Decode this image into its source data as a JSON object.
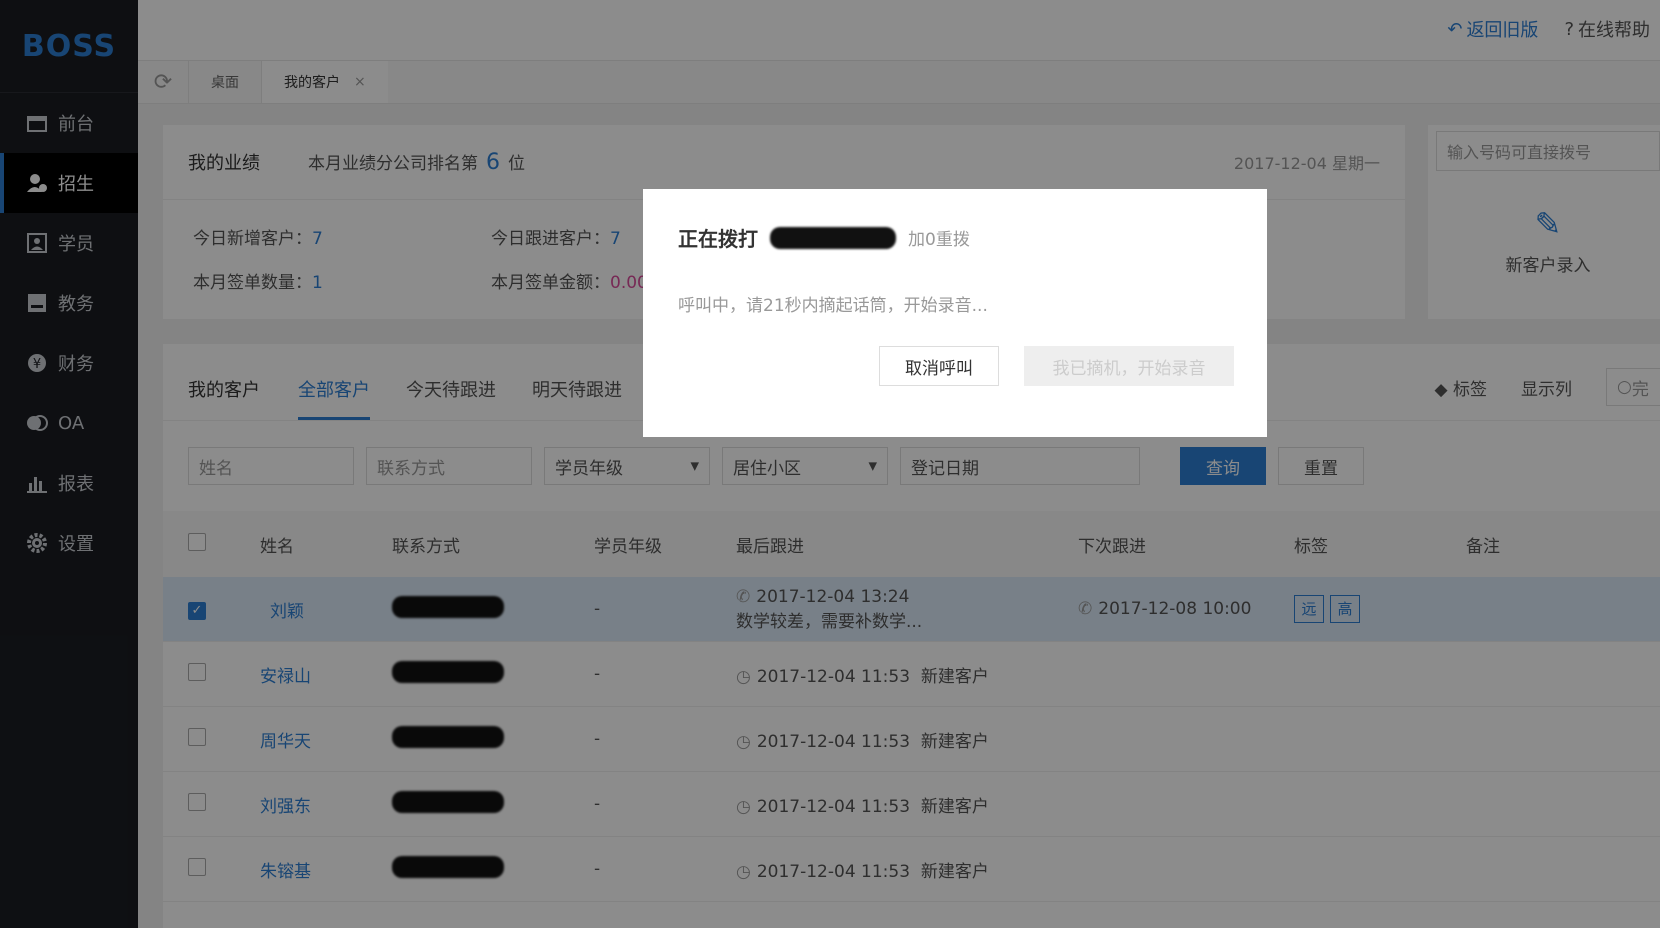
{
  "app": {
    "logo": "BOSS"
  },
  "sidebar": {
    "items": [
      {
        "label": "前台",
        "icon": "calendar-icon"
      },
      {
        "label": "招生",
        "icon": "user-add-icon",
        "active": true
      },
      {
        "label": "学员",
        "icon": "student-icon"
      },
      {
        "label": "教务",
        "icon": "book-icon"
      },
      {
        "label": "财务",
        "icon": "yen-icon"
      },
      {
        "label": "OA",
        "icon": "oa-icon"
      },
      {
        "label": "报表",
        "icon": "bar-chart-icon"
      },
      {
        "label": "设置",
        "icon": "gear-icon"
      }
    ]
  },
  "topbar": {
    "back_label": "返回旧版",
    "help_label": "在线帮助"
  },
  "tabs": {
    "home": "桌面",
    "current": "我的客户"
  },
  "performance": {
    "title": "我的业绩",
    "rank_prefix": "本月业绩分公司排名第",
    "rank_num": "6",
    "rank_suffix": "位",
    "date": "2017-12-04 星期一",
    "new_today_label": "今日新增客户：",
    "new_today": "7",
    "follow_today_label": "今日跟进客户：",
    "follow_today": "7",
    "signed_count_label": "本月签单数量：",
    "signed_count": "1",
    "signed_amount_label": "本月签单金额：",
    "signed_amount": "0.00"
  },
  "dial": {
    "placeholder": "输入号码可直接拨号",
    "new_customer": "新客户录入"
  },
  "customers": {
    "title": "我的客户",
    "tabs": [
      "全部客户",
      "今天待跟进",
      "明天待跟进"
    ],
    "tools": {
      "tags": "标签",
      "columns": "显示列",
      "search": "完"
    },
    "filters": {
      "name": "姓名",
      "contact": "联系方式",
      "grade": "学员年级",
      "community": "居住小区",
      "date": "登记日期",
      "query": "查询",
      "reset": "重置"
    },
    "columns": [
      "姓名",
      "联系方式",
      "学员年级",
      "最后跟进",
      "下次跟进",
      "标签",
      "备注"
    ],
    "rows": [
      {
        "name": "刘颖",
        "grade": "-",
        "last": "2017-12-04 13:24",
        "last_note": "数学较差，需要补数学...",
        "next": "2017-12-08 10:00",
        "tags": [
          "远",
          "高"
        ],
        "selected": true
      },
      {
        "name": "安禄山",
        "grade": "-",
        "last": "2017-12-04 11:53",
        "last_note": "新建客户"
      },
      {
        "name": "周华天",
        "grade": "-",
        "last": "2017-12-04 11:53",
        "last_note": "新建客户"
      },
      {
        "name": "刘强东",
        "grade": "-",
        "last": "2017-12-04 11:53",
        "last_note": "新建客户"
      },
      {
        "name": "朱镕基",
        "grade": "-",
        "last": "2017-12-04 11:53",
        "last_note": "新建客户"
      }
    ]
  },
  "modal": {
    "title": "正在拨打",
    "redial": "加0重拨",
    "message": "呼叫中，请21秒内摘起话筒，开始录音...",
    "cancel": "取消呼叫",
    "accept": "我已摘机，开始录音"
  }
}
